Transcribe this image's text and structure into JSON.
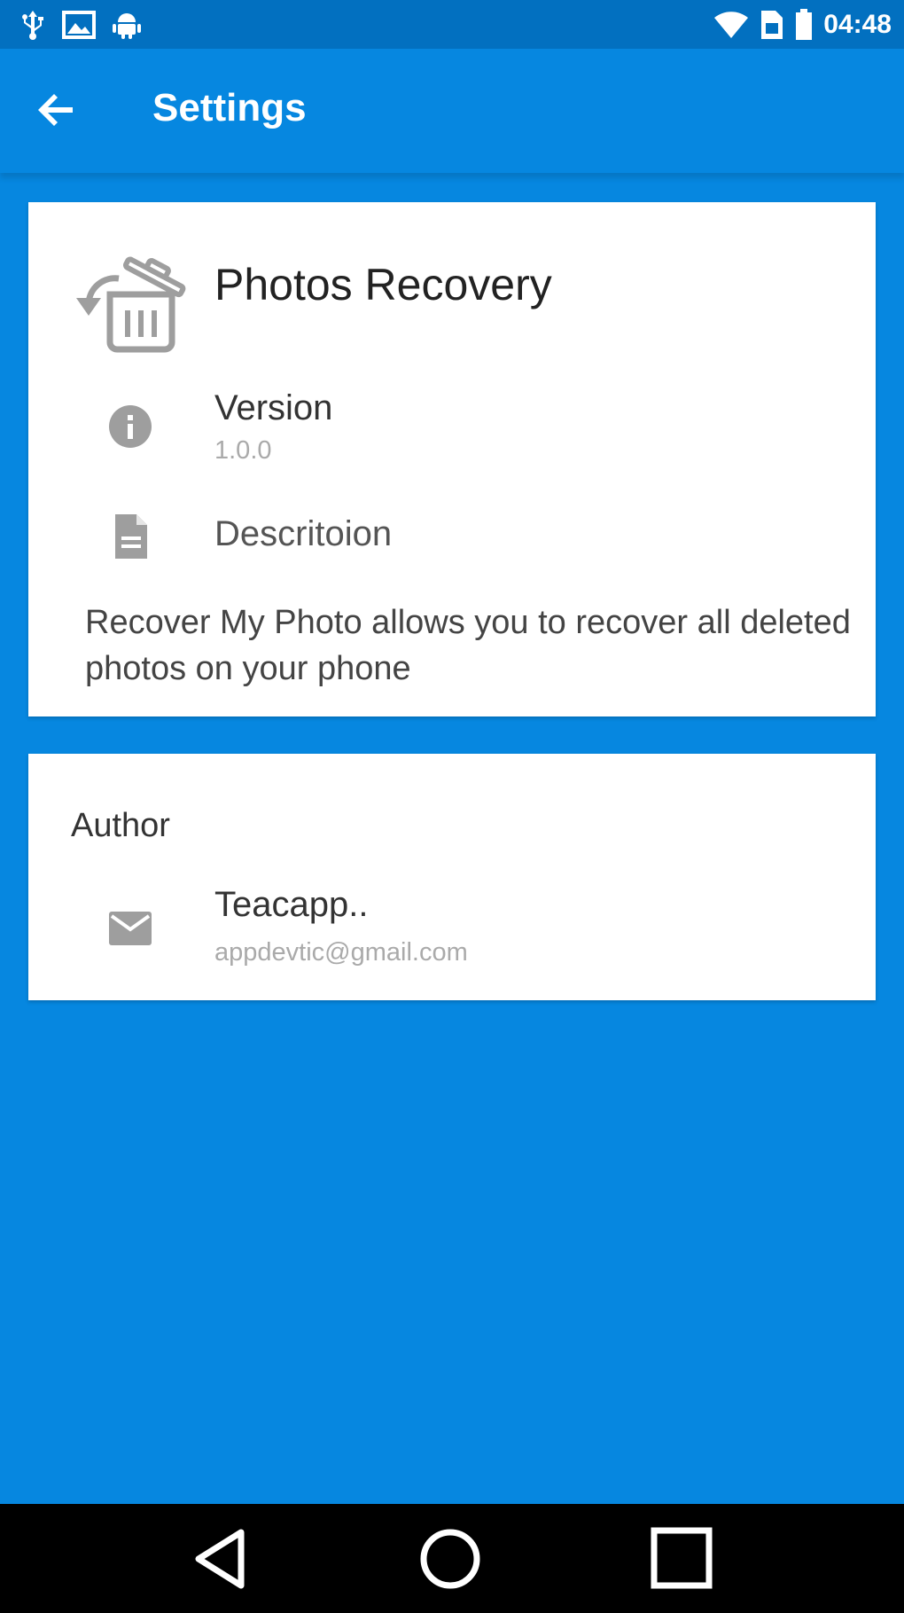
{
  "status_bar": {
    "time": "04:48",
    "left_icons": [
      "usb-icon",
      "image-icon",
      "android-icon"
    ],
    "right_icons": [
      "wifi-icon",
      "sim-icon",
      "battery-icon"
    ]
  },
  "app_bar": {
    "title": "Settings",
    "back_icon": "arrow-back-icon"
  },
  "about_card": {
    "app_name": "Photos Recovery",
    "app_icon": "trash-restore-icon",
    "version_label": "Version",
    "version_value": "1.0.0",
    "description_label": "Descritoion",
    "description_text": "Recover My Photo allows you to recover all deleted photos on your phone"
  },
  "author_card": {
    "header": "Author",
    "name": "Teacapp..",
    "email": "appdevtic@gmail.com"
  },
  "nav_bar": {
    "buttons": [
      "back-triangle-icon",
      "home-circle-icon",
      "recents-square-icon"
    ]
  },
  "colors": {
    "primary": "#0687e0",
    "status_bar": "#0270c0",
    "card": "#ffffff",
    "icon_gray": "#9e9e9e"
  }
}
